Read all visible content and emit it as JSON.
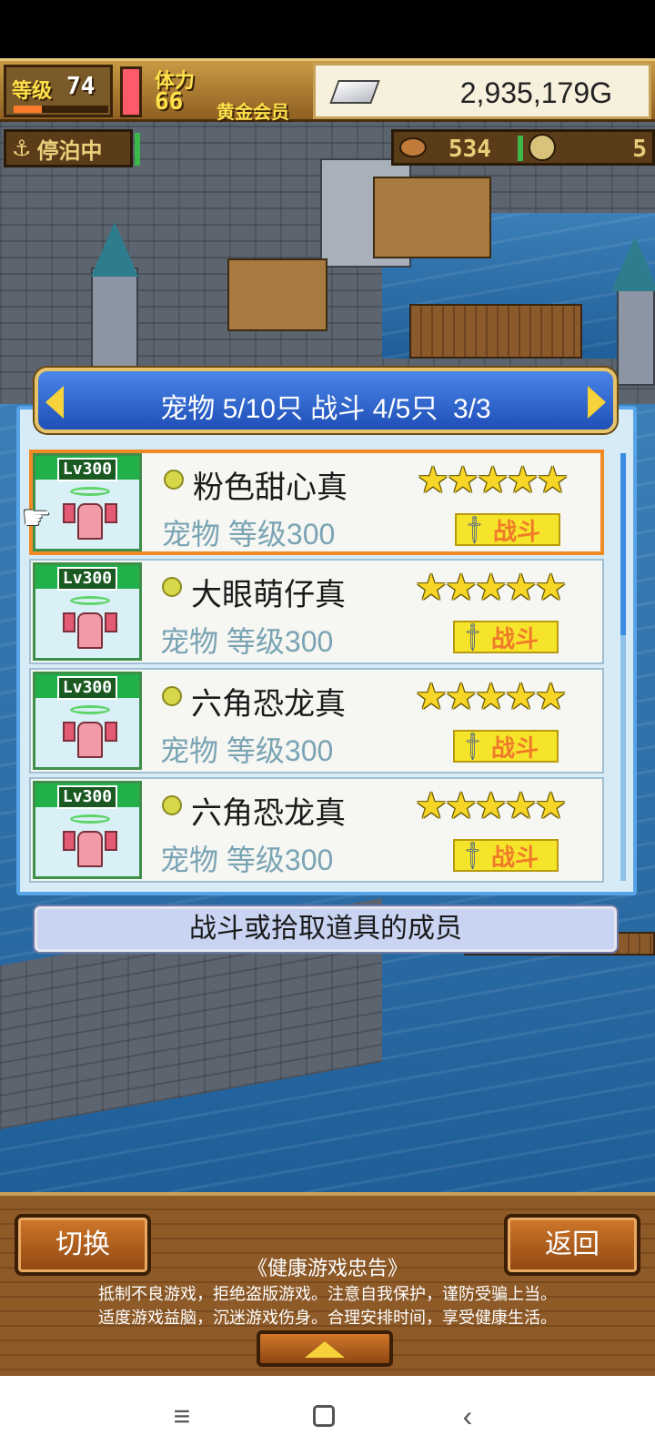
{
  "status": {
    "level_label": "等级",
    "level_value": "74",
    "level_progress": 0.3,
    "stamina_label": "体力",
    "stamina_value": "66",
    "vip_label": "黄金会员",
    "gold_value": "2,935,179G"
  },
  "port": {
    "anchor_label": "停泊中",
    "food_value": "534",
    "coin_value": "5"
  },
  "panel": {
    "title": "宠物 5/10只 战斗 4/5只  3/3",
    "pets": [
      {
        "level": "Lv300",
        "name": "粉色甜心真",
        "meta": "宠物 等级300",
        "stars": "★★★★★",
        "battle_label": "战斗",
        "selected": true
      },
      {
        "level": "Lv300",
        "name": "大眼萌仔真",
        "meta": "宠物 等级300",
        "stars": "★★★★★",
        "battle_label": "战斗",
        "selected": false
      },
      {
        "level": "Lv300",
        "name": "六角恐龙真",
        "meta": "宠物 等级300",
        "stars": "★★★★★",
        "battle_label": "战斗",
        "selected": false
      },
      {
        "level": "Lv300",
        "name": "六角恐龙真",
        "meta": "宠物 等级300",
        "stars": "★★★★★",
        "battle_label": "战斗",
        "selected": false
      }
    ],
    "hint": "战斗或拾取道具的成员"
  },
  "bottom": {
    "switch_label": "切换",
    "back_label": "返回",
    "advisory_title": "《健康游戏忠告》",
    "advisory_line1": "抵制不良游戏，拒绝盗版游戏。注意自我保护，谨防受骗上当。",
    "advisory_line2": "适度游戏益脑，沉迷游戏伤身。合理安排时间，享受健康生活。"
  },
  "nav": {
    "menu_icon": "≡",
    "back_icon": "‹"
  }
}
